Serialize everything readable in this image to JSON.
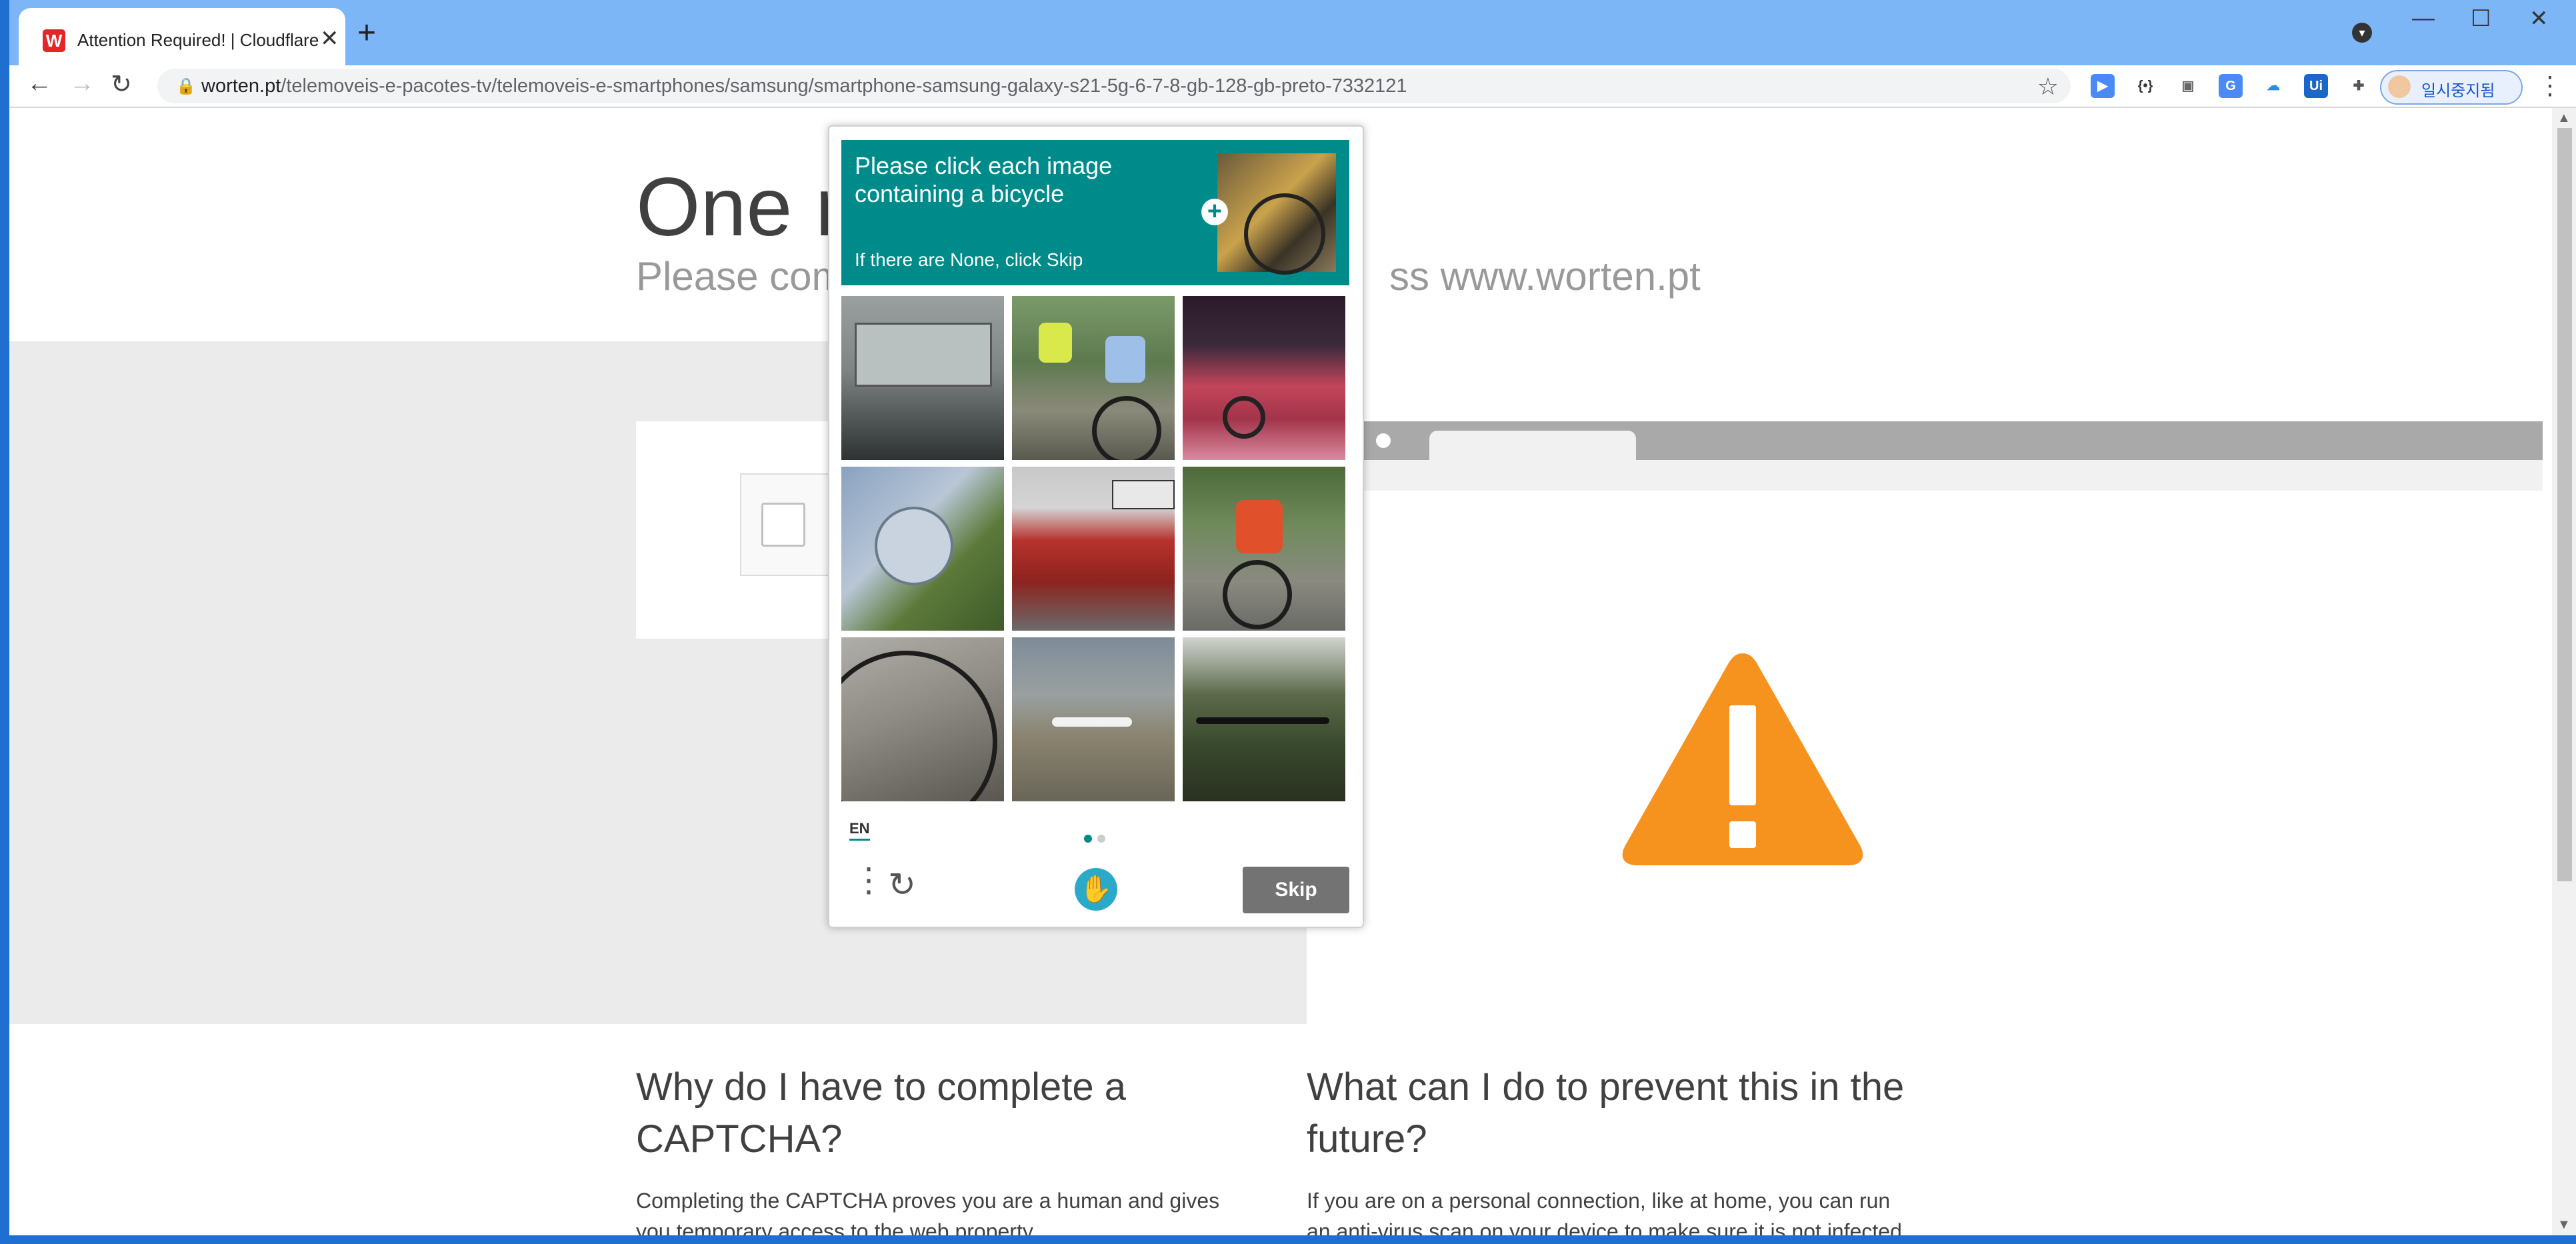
{
  "browser": {
    "tab_title": "Attention Required! | Cloudflare",
    "tab_close": "✕",
    "new_tab": "+",
    "url_host": "worten.pt",
    "url_path": "/telemoveis-e-pacotes-tv/telemoveis-e-smartphones/samsung/smartphone-samsung-galaxy-s21-5g-6-7-8-gb-128-gb-preto-7332121",
    "profile_name": "일시중지됨",
    "window_controls": [
      "minimize-icon",
      "maximize-icon",
      "close-icon"
    ]
  },
  "page": {
    "heading_start": "One m",
    "subheading_start": "Please com",
    "subheading_end": "ss www.worten.pt",
    "why_heading": "Why do I have to complete a CAPTCHA?",
    "why_text": "Completing the CAPTCHA proves you are a human and gives you temporary access to the web property.",
    "prevent_heading": "What can I do to prevent this in the future?",
    "prevent_text": "If you are on a personal connection, like at home, you can run an anti-virus scan on your device to make sure it is not infected with malware."
  },
  "captcha": {
    "prompt": "Please click each image containing a bicycle",
    "hint": "If there are None, click Skip",
    "language": "EN",
    "skip_label": "Skip",
    "tiles": [
      "bus",
      "cyclists",
      "red car",
      "airplane propeller",
      "fire truck",
      "cyclist",
      "bicycle wheel",
      "airplane on runway",
      "bicycle handlebar"
    ],
    "page_indicator": {
      "current": 1,
      "total": 2
    }
  },
  "colors": {
    "tabbar": "#7db6f7",
    "captcha_teal": "#008b8b",
    "warning_orange": "#f6921e",
    "skip_gray": "#737373"
  }
}
